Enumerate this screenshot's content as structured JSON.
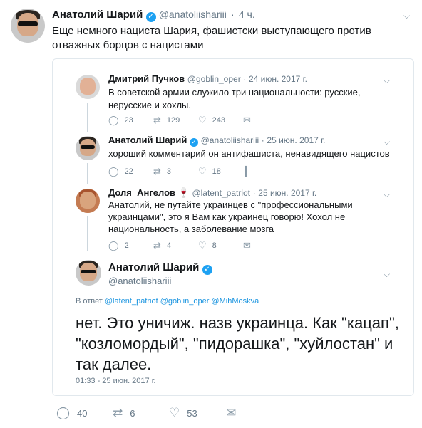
{
  "tweet": {
    "author_name": "Анатолий Шарий",
    "author_handle": "@anatoliishariii",
    "time": "4 ч.",
    "separator": "·",
    "text": "Еще немного нациста Шария, фашистски выступающего против отважных борцов с нацистами",
    "actions": {
      "replies": "40",
      "retweets": "6",
      "likes": "53"
    }
  },
  "quoted": {
    "replies": [
      {
        "author_name": "Дмитрий Пучков",
        "author_handle": "@goblin_oper",
        "date": "24 июн. 2017 г.",
        "text": "В советской армии служило три национальности: русские, нерусские и хохлы.",
        "replies": "23",
        "retweets": "129",
        "likes": "243"
      },
      {
        "author_name": "Анатолий Шарий",
        "author_handle": "@anatoliishariii",
        "date": "25 июн. 2017 г.",
        "text": "хороший комментарий он антифашиста, ненавидящего нацистов",
        "replies": "22",
        "retweets": "3",
        "likes": "18"
      },
      {
        "author_name": "Доля_Ангелов 🍷",
        "author_handle": "@latent_patriot",
        "date": "25 июн. 2017 г.",
        "text": "Анатолий, не путайте украинцев с \"профессиональными украинцами\", это я Вам как украинец говорю! Хохол не национальность, а заболевание мозга",
        "replies": "2",
        "retweets": "4",
        "likes": "8"
      }
    ],
    "main": {
      "author_name": "Анатолий Шарий",
      "author_handle": "@anatoliishariii",
      "reply_prefix": "В ответ",
      "reply_to": "@latent_patriot @goblin_oper @MihMoskva",
      "text": "нет. Это уничиж. назв украинца. Как \"кацап\", \"козломордый\", \"пидорашка\", \"хуйлостан\" и так далее.",
      "timestamp": "01:33 - 25 июн. 2017 г."
    }
  },
  "icons": {
    "reply": "reply-icon",
    "retweet": "retweet-icon",
    "like": "heart-icon",
    "dm": "mail-icon",
    "stats": "stats-icon",
    "more": "chevron-down-icon",
    "verified": "verified-icon"
  },
  "colors": {
    "accent": "#1da1f2",
    "link": "#1b95e0",
    "muted": "#657786",
    "border": "#e1e8ed"
  }
}
